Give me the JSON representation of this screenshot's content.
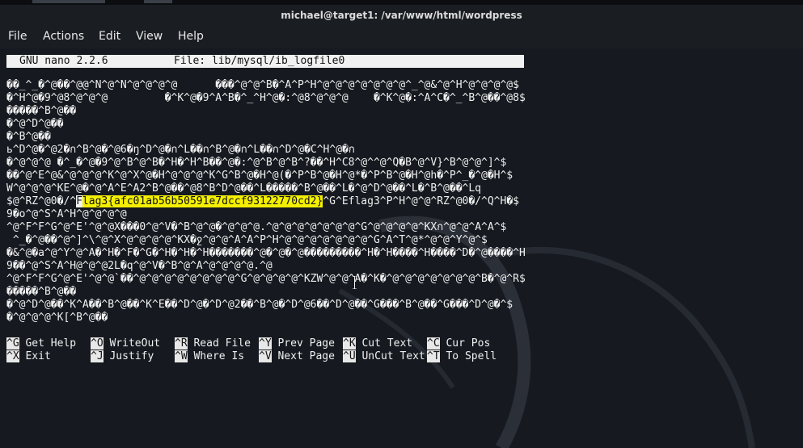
{
  "window": {
    "title": "michael@target1: /var/www/html/wordpress"
  },
  "menu": [
    {
      "label": "File"
    },
    {
      "label": "Actions"
    },
    {
      "label": "Edit"
    },
    {
      "label": "View"
    },
    {
      "label": "Help"
    }
  ],
  "nano": {
    "version": "GNU nano 2.2.6",
    "file": "File: lib/mysql/ib_logfile0"
  },
  "editor": {
    "lines": [
      "��_^_�^@��^@@^N^@^N^@^@^@^@      ���^@^@^B�^A^P^H^@^@^@^@^@^@^@^_^@&^@^H^@^@^@^@$",
      "�^H^@�9^@8^@^@^@         �^K^@�9^A^B�^_^H^@�:^@8^@^@^@    �^K^@�:^A^C�^_^B^@��^@8$",
      "�����^B^@��",
      "�^@^D^@��",
      "�^B^@��",
      "ь^D^@�^@2�ก^B^@�^@6�ŋ^D^@�ก^L��ก^B^@�ก^L��ก^D^@�C^H^@�ก",
      "�^@^@^@ �^_�^@�9^@^B^@^B�^H�^H^B��^@�:^@^B^@^B^?��^H^C8^@^^@^Q�B^@^V}^B^@^@^]^$",
      "��^@^E^@&^@^@^@^K^@^X^@�H^@^@^@^K^G^B^@�H^@(�^P^B^@�H^@*�^P^B^@�H^@h�^P^_�^@�H^$",
      "W^@^@^@^KE^@�^@^A^E^A2^B^@��^@8^B^D^@��^L�����^B^@��^L�^@^D^@��^L�^B^@��^Lq",
      "$@^RZ^@0�/^",
      "9�o^@^S^A^H^@^@^@^@",
      "^@^F^F^G^@^E'^@^@X���0^@^V�^B^@^@�^@^@^@.^@^@^@^@^@^@^@^G^@^@^@^@^KXก^@^@^A^A^$",
      " ^_�^@��^@^]^\\^@^X^@^@^@^@^KX�ջ^@^@^A^A^P^H^@^@^@^@^@^@^@^G^A^T^@*^@^@^Y^@^$",
      "�&^@�a^@^Y^@^A�^H�^F�^G�^H�^H�^H�������^@�^@�^@���������^H�^H����^H����^D�^@����^H",
      "9��^@^S^A^H@^@^@2L�q^@^V�^B^@^A^@^@^@^@.^@",
      "^@^F^F^G^@^E'^@^@`��^@^@^@^@^@^@^@^@^G^@^@^@^@^KZW^@^@^A�^K�^@^@^@^@^@^@^@^B�^@^R$",
      "�����^B^@��",
      "�^@^D^@��^K^A��^B^@��^K^E��^D^@�^D^@2��^B^@�^D^@6��^D^@��^G���^B^@��^G���^D^@�^$",
      "�^@^@^@^K[^B^@��"
    ],
    "flag_prefix_highlight": "F",
    "flag_text": "lag3{afc01ab56b50591e7dccf93122770cd2}",
    "flag_line_suffix": "^G^Eflag3^P^H^@^@^RZ^@0�/^Q^H�$"
  },
  "shortcuts": {
    "row1": [
      {
        "key": "^G",
        "label": "Get Help"
      },
      {
        "key": "^O",
        "label": "WriteOut"
      },
      {
        "key": "^R",
        "label": "Read File"
      },
      {
        "key": "^Y",
        "label": "Prev Page"
      },
      {
        "key": "^K",
        "label": "Cut Text"
      },
      {
        "key": "^C",
        "label": "Cur Pos"
      }
    ],
    "row2": [
      {
        "key": "^X",
        "label": "Exit"
      },
      {
        "key": "^J",
        "label": "Justify"
      },
      {
        "key": "^W",
        "label": "Where Is"
      },
      {
        "key": "^V",
        "label": "Next Page"
      },
      {
        "key": "^U",
        "label": "UnCut Text"
      },
      {
        "key": "^T",
        "label": "To Spell"
      }
    ]
  },
  "colors": {
    "background": "#161a20",
    "highlight": "#f4f000",
    "header_bar": "#f1f1f1"
  }
}
